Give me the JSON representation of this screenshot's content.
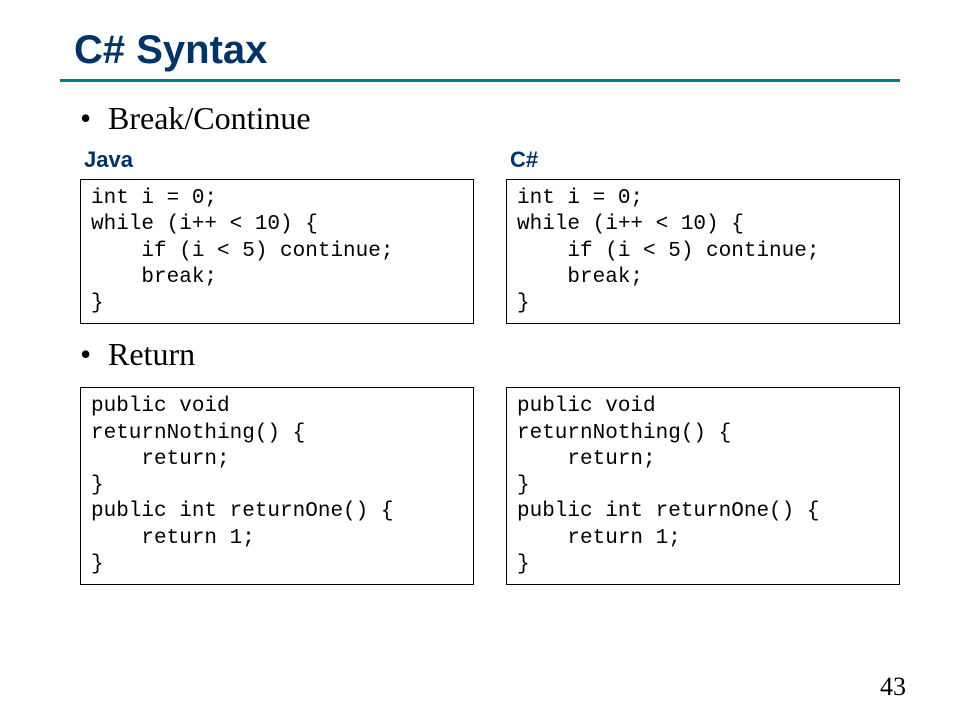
{
  "title": "C# Syntax",
  "bullets": {
    "break_continue": "Break/Continue",
    "return": "Return"
  },
  "labels": {
    "java": "Java",
    "csharp": "C#"
  },
  "code": {
    "break_java": "int i = 0;\nwhile (i++ < 10) {\n    if (i < 5) continue;\n    break;\n}",
    "break_csharp": "int i = 0;\nwhile (i++ < 10) {\n    if (i < 5) continue;\n    break;\n}",
    "return_java": "public void\nreturnNothing() {\n    return;\n}\npublic int returnOne() {\n    return 1;\n}",
    "return_csharp": "public void\nreturnNothing() {\n    return;\n}\npublic int returnOne() {\n    return 1;\n}"
  },
  "page_number": "43"
}
